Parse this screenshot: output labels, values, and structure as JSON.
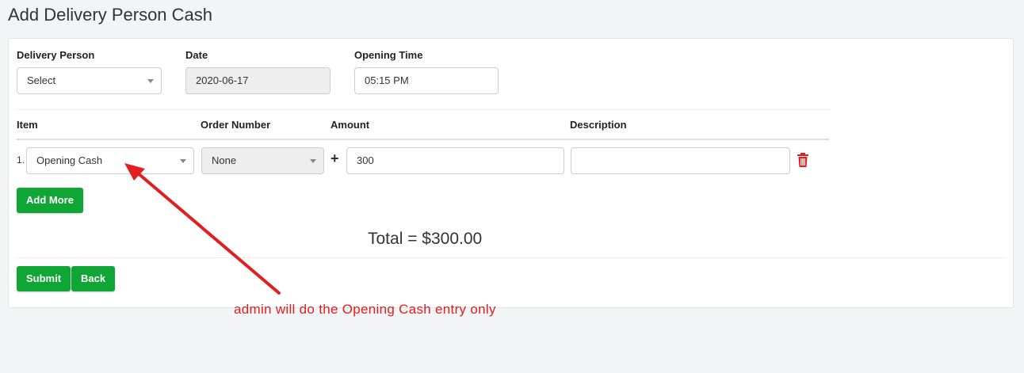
{
  "page": {
    "title": "Add Delivery Person Cash"
  },
  "form": {
    "delivery_person": {
      "label": "Delivery Person",
      "value": "Select"
    },
    "date": {
      "label": "Date",
      "value": "2020-06-17"
    },
    "opening_time": {
      "label": "Opening Time",
      "value": "05:15 PM"
    }
  },
  "table": {
    "headers": [
      "Item",
      "Order Number",
      "Amount",
      "Description"
    ],
    "rows": [
      {
        "number": "1.",
        "item": "Opening Cash",
        "order_number": "None",
        "amount": "300",
        "description": ""
      }
    ]
  },
  "add_more_label": "Add More",
  "total_text": "Total = $300.00",
  "actions": {
    "submit_label": "Submit",
    "back_label": "Back"
  },
  "annotation": {
    "text": "admin will do the Opening Cash entry only",
    "color": "#e02020"
  },
  "colors": {
    "primary": "#10a636",
    "danger": "#e02020"
  },
  "icons": {
    "add_amount": "plus-icon",
    "delete_row": "trash-icon"
  }
}
